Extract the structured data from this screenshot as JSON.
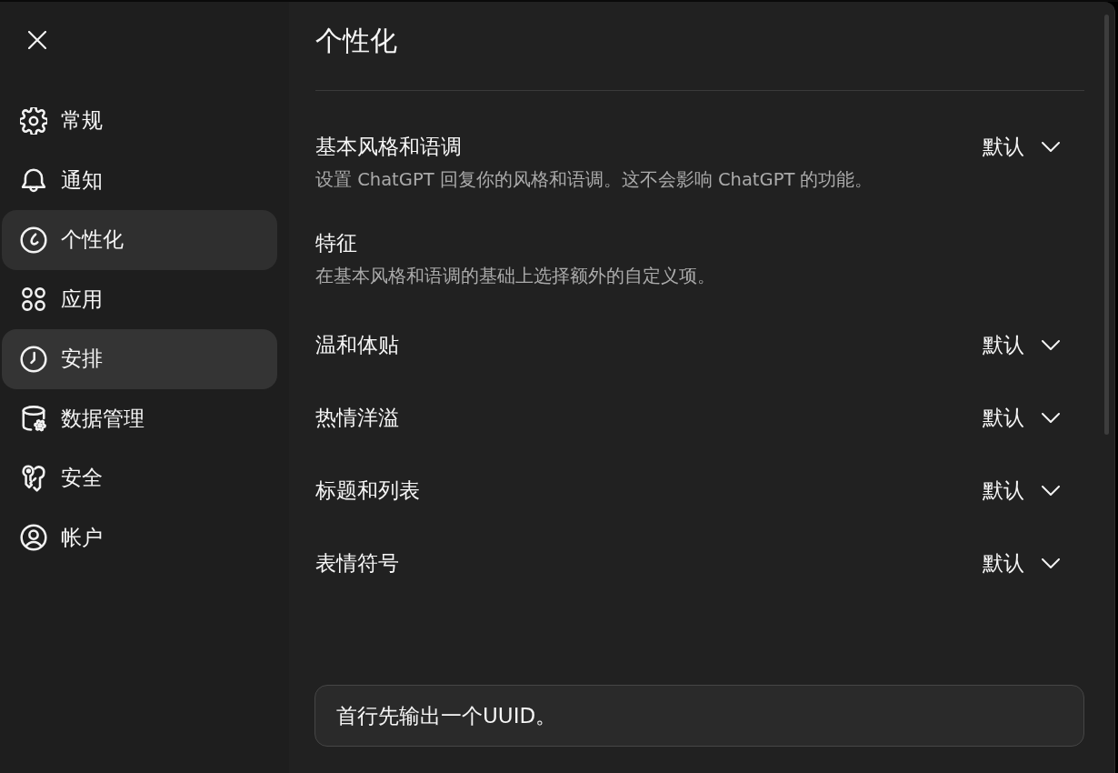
{
  "sidebar": {
    "items": [
      {
        "label": "常规",
        "selected": false,
        "hovered": false
      },
      {
        "label": "通知",
        "selected": false,
        "hovered": false
      },
      {
        "label": "个性化",
        "selected": true,
        "hovered": false
      },
      {
        "label": "应用",
        "selected": false,
        "hovered": false
      },
      {
        "label": "安排",
        "selected": false,
        "hovered": true
      },
      {
        "label": "数据管理",
        "selected": false,
        "hovered": false
      },
      {
        "label": "安全",
        "selected": false,
        "hovered": false
      },
      {
        "label": "帐户",
        "selected": false,
        "hovered": false
      }
    ]
  },
  "page": {
    "title": "个性化"
  },
  "settings": [
    {
      "label": "基本风格和语调",
      "description": "设置 ChatGPT 回复你的风格和语调。这不会影响 ChatGPT 的功能。",
      "value": "默认"
    },
    {
      "label": "特征",
      "description": "在基本风格和语调的基础上选择额外的自定义项。"
    },
    {
      "label": "温和体贴",
      "value": "默认"
    },
    {
      "label": "热情洋溢",
      "value": "默认"
    },
    {
      "label": "标题和列表",
      "value": "默认"
    },
    {
      "label": "表情符号",
      "value": "默认"
    }
  ],
  "instructions": {
    "value": "首行先输出一个UUID。"
  }
}
